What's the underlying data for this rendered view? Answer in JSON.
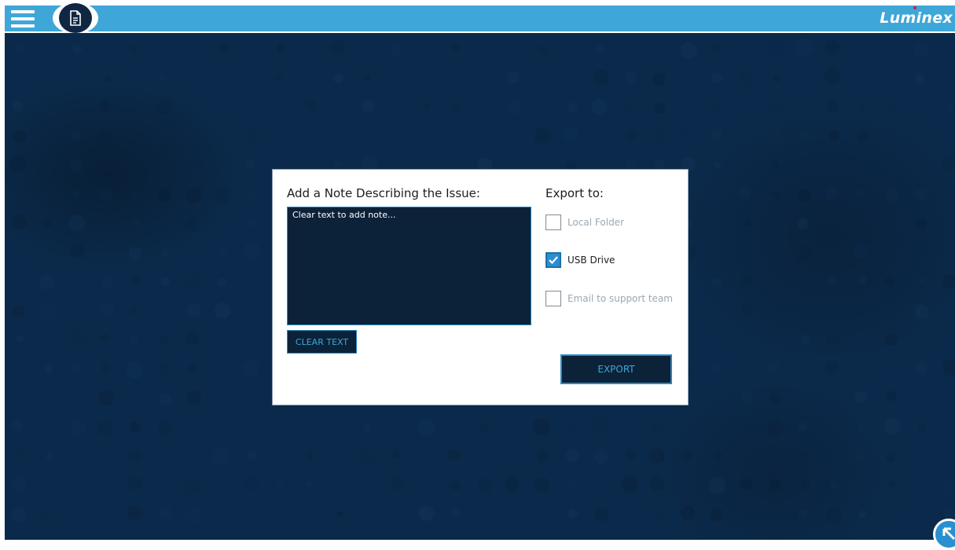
{
  "header": {
    "brand": "Luminex",
    "menu_icon": "hamburger-menu-icon",
    "doc_icon": "document-icon"
  },
  "dialog": {
    "note_label": "Add a Note Describing the Issue:",
    "note_value": "Clear text to add note...",
    "clear_button": "CLEAR TEXT",
    "export_label": "Export to:",
    "options": [
      {
        "label": "Local Folder",
        "checked": false
      },
      {
        "label": "USB Drive",
        "checked": true
      },
      {
        "label": "Email to support team",
        "checked": false
      }
    ],
    "export_button": "EXPORT"
  },
  "colors": {
    "header": "#3fa6d8",
    "background": "#0b2a4b",
    "accent": "#2a89c2",
    "field": "#0c2238"
  },
  "corner_icon": "arrow-up-left-icon"
}
